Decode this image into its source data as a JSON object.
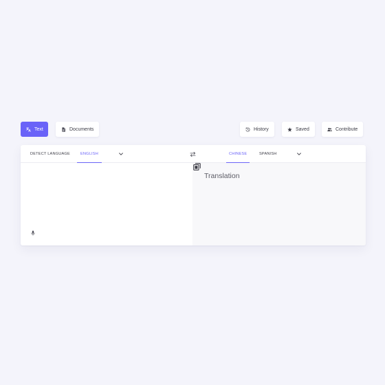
{
  "toolbar": {
    "text_label": "Text",
    "documents_label": "Documents",
    "history_label": "History",
    "saved_label": "Saved",
    "contribute_label": "Contribute"
  },
  "source_languages": {
    "detect_label": "DETECT LANGUAGE",
    "selected_label": "ENGLISH"
  },
  "target_languages": {
    "selected_label": "CHINESE",
    "other_label": "SPANISH"
  },
  "output": {
    "placeholder": "Translation"
  },
  "colors": {
    "accent": "#6a63f8",
    "background": "#f4f4fb",
    "panel": "#ffffff",
    "output_panel": "#f8f8fa"
  },
  "icons": {
    "text": "translate-icon",
    "documents": "document-icon",
    "history": "history-icon",
    "saved": "star-icon",
    "contribute": "people-icon",
    "swap": "swap-icon",
    "dropdown": "chevron-down-icon",
    "mic": "microphone-icon",
    "copy": "copy-icon"
  }
}
